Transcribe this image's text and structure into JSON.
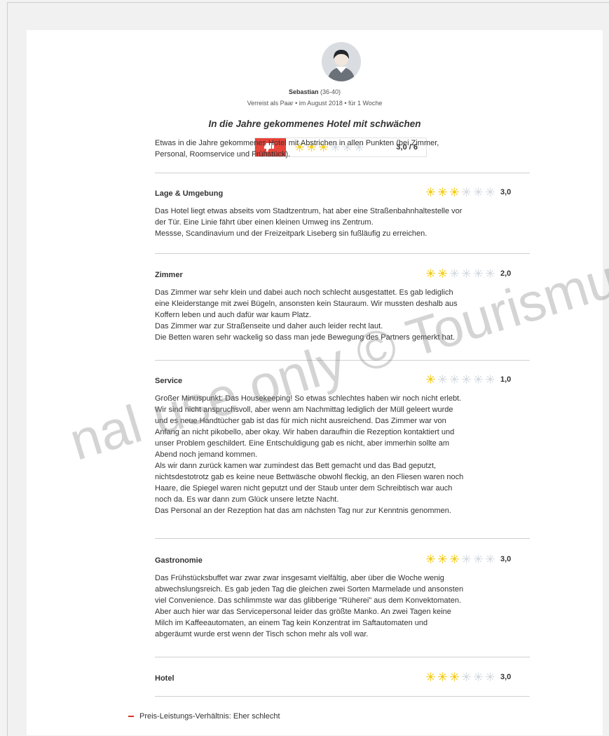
{
  "reviewer": {
    "name": "Sebastian",
    "age": "(36-40)",
    "trip_info": "Verreist als Paar • im August 2018 • für 1 Woche"
  },
  "review": {
    "title": "In die Jahre gekommenes Hotel mit schwächen",
    "overall_score": "3,0 / 6",
    "overall_stars": 3,
    "recommendation_icon": "thumbs-down-icon",
    "summary": "Etwas in die Jahre gekommenes Hotel mit Abstrichen in allen Punkten (bei Zimmer,\nPersonal, Roomservice und Frühstück)."
  },
  "sections": [
    {
      "title": "Lage & Umgebung",
      "score": "3,0",
      "stars": 3,
      "text": "Das Hotel liegt etwas abseits vom Stadtzentrum, hat aber eine Straßenbahnhaltestelle vor\nder Tür. Eine Linie fährt über einen kleinen Umweg ins Zentrum.\nMessse, Scandinavium und der Freizeitpark Liseberg sin fußläufig zu erreichen."
    },
    {
      "title": "Zimmer",
      "score": "2,0",
      "stars": 2,
      "text": "Das Zimmer war sehr klein und dabei auch noch schlecht ausgestattet. Es gab lediglich\neine Kleiderstange mit zwei Bügeln, ansonsten kein Stauraum. Wir mussten deshalb aus\nKoffern leben und auch dafür war kaum Platz.\nDas Zimmer war zur Straßenseite und daher auch leider recht laut.\nDie Betten waren sehr wackelig so dass man jede Bewegung des Partners gemerkt hat."
    },
    {
      "title": "Service",
      "score": "1,0",
      "stars": 1,
      "text": "Großer Minuspunkt: Das Housekeeping! So etwas schlechtes haben wir noch nicht erlebt.\nWir sind nicht anspruchsvoll, aber wenn am Nachmittag lediglich der Müll geleert wurde\nund es neue Handtücher gab ist das für mich nicht ausreichend. Das Zimmer war von\nAnfang an nicht pikobello, aber okay. Wir haben daraufhin die Rezeption kontaktiert und\nunser Problem geschildert. Eine Entschuldigung gab es nicht, aber immerhin sollte am\nAbend noch jemand kommen.\nAls wir dann zurück kamen war zumindest das Bett gemacht und das Bad geputzt,\nnichtsdestotrotz gab es keine neue Bettwäsche obwohl fleckig, an den Fliesen waren noch\nHaare, die Spiegel waren nicht geputzt und der Staub unter dem Schreibtisch war auch\nnoch da. Es war dann zum Glück unsere letzte Nacht.\nDas Personal an der Rezeption hat das am nächsten Tag nur zur Kenntnis genommen."
    },
    {
      "title": "Gastronomie",
      "score": "3,0",
      "stars": 3,
      "text": "Das Frühstücksbuffet war zwar zwar insgesamt vielfältig, aber über die Woche wenig\nabwechslungsreich. Es gab jeden Tag die gleichen zwei Sorten Marmelade und ansonsten\nviel Convenience. Das schlimmste war das glibberige \"Rüherei\" aus dem Konvektomaten.\nAber auch hier war das Servicepersonal leider das größte Manko. An zwei Tagen keine\nMilch im Kaffeeautomaten, an einem Tag kein Konzentrat im Saftautomaten und\nabgeräumt wurde erst wenn der Tisch schon mehr als voll war."
    },
    {
      "title": "Hotel",
      "score": "3,0",
      "stars": 3,
      "text": ""
    }
  ],
  "value_for_money": {
    "icon": "minus-icon",
    "text": "Preis-Leistungs-Verhältnis: Eher schlecht"
  },
  "watermark": "nal use only © Tourismu",
  "colors": {
    "star_active": "#f5cc16",
    "star_inactive": "#d6dce2",
    "thumb_bg": "#e8443a",
    "minus": "#d8342a"
  }
}
